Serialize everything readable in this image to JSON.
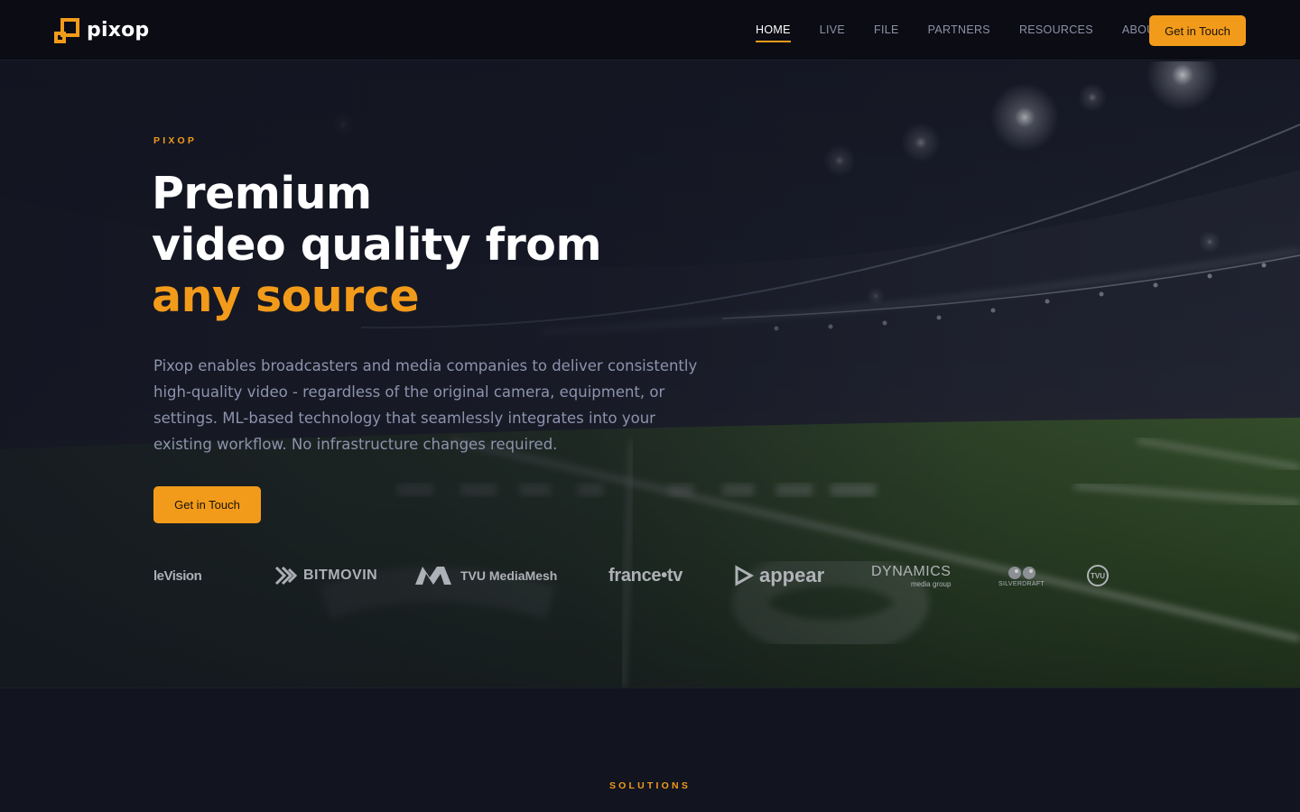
{
  "brand": {
    "name": "pixop",
    "accent": "#f29b1b"
  },
  "nav": {
    "links": [
      "HOME",
      "LIVE",
      "FILE",
      "PARTNERS",
      "RESOURCES",
      "ABOUT"
    ],
    "active": "HOME",
    "cta": "Get in Touch"
  },
  "hero": {
    "eyebrow": "PIXOP",
    "headline_line1": "Premium",
    "headline_line2": "video quality from",
    "headline_accent": "any source",
    "description": "Pixop enables broadcasters and media companies to deliver consistently high-quality video - regardless of the original camera, equipment, or settings. ML-based technology that seamlessly integrates into your existing workflow. No infrastructure changes required.",
    "cta": "Get in Touch",
    "partners": [
      {
        "name": "leVision",
        "icon": "wordmark"
      },
      {
        "name": "BITMOVIN",
        "icon": "bitmovin-chevrons-icon"
      },
      {
        "name": "TVU MediaMesh",
        "icon": "tvu-m-icon"
      },
      {
        "name": "france•tv",
        "icon": "wordmark"
      },
      {
        "name": "appear",
        "icon": "appear-play-icon"
      },
      {
        "name": "DYNAMICS",
        "subtitle": "media group",
        "icon": "wordmark"
      },
      {
        "name": "SILVERDRAFT",
        "icon": "silverdraft-eyes-icon"
      },
      {
        "name": "TVU",
        "icon": "tvu-circle-icon"
      }
    ]
  },
  "solutions": {
    "eyebrow": "SOLUTIONS"
  }
}
